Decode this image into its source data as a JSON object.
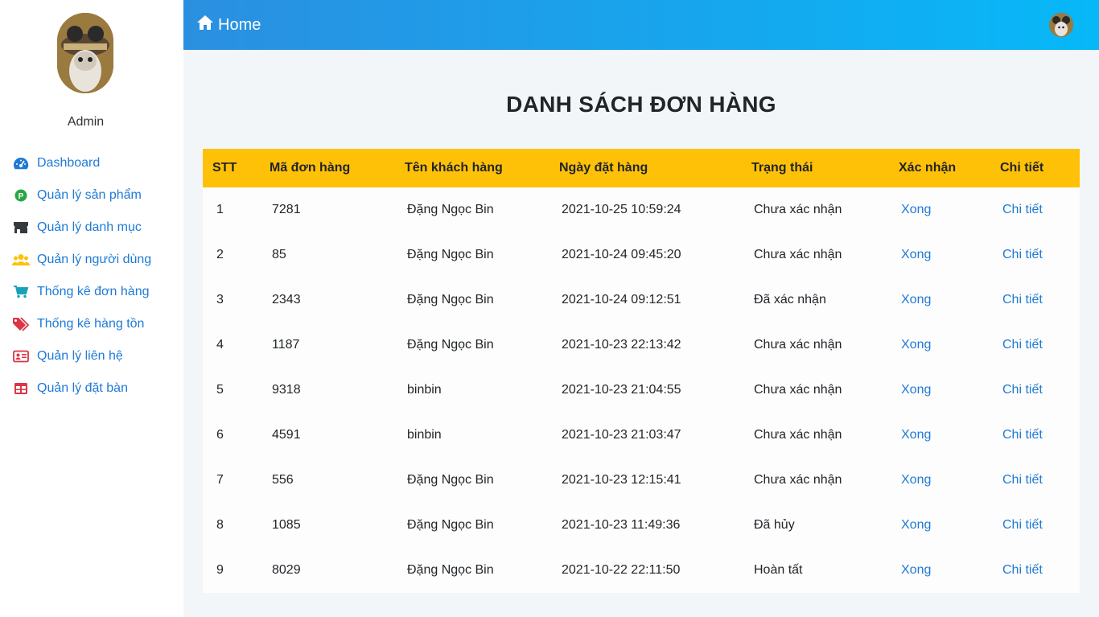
{
  "user": {
    "name": "Admin"
  },
  "sidebar": {
    "items": [
      {
        "label": "Dashboard",
        "icon": "gauge-icon",
        "color": "#1e7ad6"
      },
      {
        "label": "Quản lý sản phẩm",
        "icon": "parking-circle-icon",
        "color": "#28a745"
      },
      {
        "label": "Quản lý danh mục",
        "icon": "store-icon",
        "color": "#343a40"
      },
      {
        "label": "Quản lý người dùng",
        "icon": "users-icon",
        "color": "#ffc107"
      },
      {
        "label": "Thống kê đơn hàng",
        "icon": "cart-icon",
        "color": "#17a2b8"
      },
      {
        "label": "Thống kê hàng tồn",
        "icon": "tags-icon",
        "color": "#dc3545"
      },
      {
        "label": "Quản lý liên hệ",
        "icon": "id-card-icon",
        "color": "#dc3545"
      },
      {
        "label": "Quản lý đặt bàn",
        "icon": "table-icon",
        "color": "#dc3545"
      }
    ]
  },
  "header": {
    "home_label": "Home"
  },
  "main": {
    "title": "DANH SÁCH ĐƠN HÀNG",
    "columns": [
      "STT",
      "Mã đơn hàng",
      "Tên khách hàng",
      "Ngày đặt hàng",
      "Trạng thái",
      "Xác nhận",
      "Chi tiết"
    ],
    "rows": [
      {
        "stt": "1",
        "code": "7281",
        "customer": "Đặng Ngọc Bin",
        "date": "2021-10-25 10:59:24",
        "status": "Chưa xác nhận",
        "confirm": "Xong",
        "detail": "Chi tiết"
      },
      {
        "stt": "2",
        "code": "85",
        "customer": "Đặng Ngọc Bin",
        "date": "2021-10-24 09:45:20",
        "status": "Chưa xác nhận",
        "confirm": "Xong",
        "detail": "Chi tiết"
      },
      {
        "stt": "3",
        "code": "2343",
        "customer": "Đặng Ngọc Bin",
        "date": "2021-10-24 09:12:51",
        "status": "Đã xác nhận",
        "confirm": "Xong",
        "detail": "Chi tiết"
      },
      {
        "stt": "4",
        "code": "1187",
        "customer": "Đặng Ngọc Bin",
        "date": "2021-10-23 22:13:42",
        "status": "Chưa xác nhận",
        "confirm": "Xong",
        "detail": "Chi tiết"
      },
      {
        "stt": "5",
        "code": "9318",
        "customer": "binbin",
        "date": "2021-10-23 21:04:55",
        "status": "Chưa xác nhận",
        "confirm": "Xong",
        "detail": "Chi tiết"
      },
      {
        "stt": "6",
        "code": "4591",
        "customer": "binbin",
        "date": "2021-10-23 21:03:47",
        "status": "Chưa xác nhận",
        "confirm": "Xong",
        "detail": "Chi tiết"
      },
      {
        "stt": "7",
        "code": "556",
        "customer": "Đặng Ngọc Bin",
        "date": "2021-10-23 12:15:41",
        "status": "Chưa xác nhận",
        "confirm": "Xong",
        "detail": "Chi tiết"
      },
      {
        "stt": "8",
        "code": "1085",
        "customer": "Đặng Ngọc Bin",
        "date": "2021-10-23 11:49:36",
        "status": "Đã hủy",
        "confirm": "Xong",
        "detail": "Chi tiết"
      },
      {
        "stt": "9",
        "code": "8029",
        "customer": "Đặng Ngọc Bin",
        "date": "2021-10-22 22:11:50",
        "status": "Hoàn tất",
        "confirm": "Xong",
        "detail": "Chi tiết"
      }
    ]
  },
  "colors": {
    "accent": "#1e7ad6",
    "table_header": "#ffc107",
    "topbar_start": "#2b8fe0",
    "topbar_end": "#07b8f8"
  }
}
